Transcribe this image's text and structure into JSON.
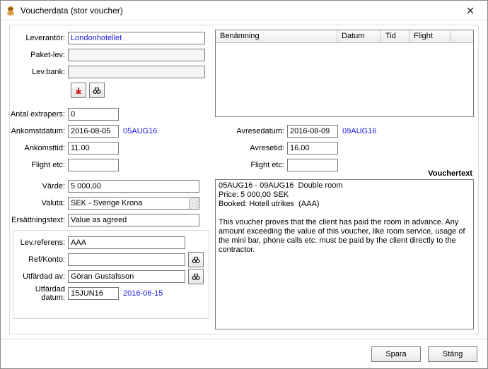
{
  "window": {
    "title": "Voucherdata (stor voucher)"
  },
  "labels": {
    "leverantor": "Leverantör:",
    "paketlev": "Paket-lev:",
    "levbank": "Lev.bank:",
    "antal_extrapers": "Antal extrapers:",
    "ankomstdatum": "Ankomstdatum:",
    "ankomsttid": "Ankomsttid:",
    "flight_etc_left": "Flight etc:",
    "avresedatum": "Avresedatum:",
    "avresetid": "Avresetid:",
    "flight_etc_right": "Flight etc:",
    "varde": "Värde:",
    "valuta": "Valuta:",
    "ersattningstext": "Ersättningstext:",
    "lev_referens": "Lev.referens:",
    "ref_konto": "Ref/Konto:",
    "utfardad_av": "Utfärdad av:",
    "utfardad_datum": "Utfärdad datum:",
    "vouchertext": "Vouchertext"
  },
  "values": {
    "leverantor": "Londonhotellet",
    "paketlev": "",
    "levbank": "",
    "antal_extrapers": "0",
    "ankomstdatum": "2016-08-05",
    "ankomstdatum_alt": "05AUG16",
    "ankomsttid": "11.00",
    "flight_etc_left": "",
    "avresedatum": "2016-08-09",
    "avresedatum_alt": "09AUG16",
    "avresetid": "16.00",
    "flight_etc_right": "",
    "varde": "5 000,00",
    "valuta": "SEK  - Sverige Krona",
    "ersattningstext": "Value as agreed",
    "lev_referens": "AAA",
    "ref_konto": "",
    "utfardad_av": "Göran Gustafsson",
    "utfardad_datum": "15JUN16",
    "utfardad_datum_alt": "2016-06-15"
  },
  "table": {
    "columns": {
      "benamning": "Benämning",
      "datum": "Datum",
      "tid": "Tid",
      "flight": "Flight"
    },
    "rows": []
  },
  "vouchertext": "05AUG16 - 09AUG16  Double room\nPrice: 5 000,00 SEK\nBooked: Hotell utrikes  (AAA)\n\nThis voucher proves that the client has paid the room in advance. Any amount exceeding the value of this voucher, like room service, usage of the mini bar, phone calls etc. must be paid by the client directly to the contractor.",
  "footer": {
    "save": "Spara",
    "close": "Stäng"
  }
}
